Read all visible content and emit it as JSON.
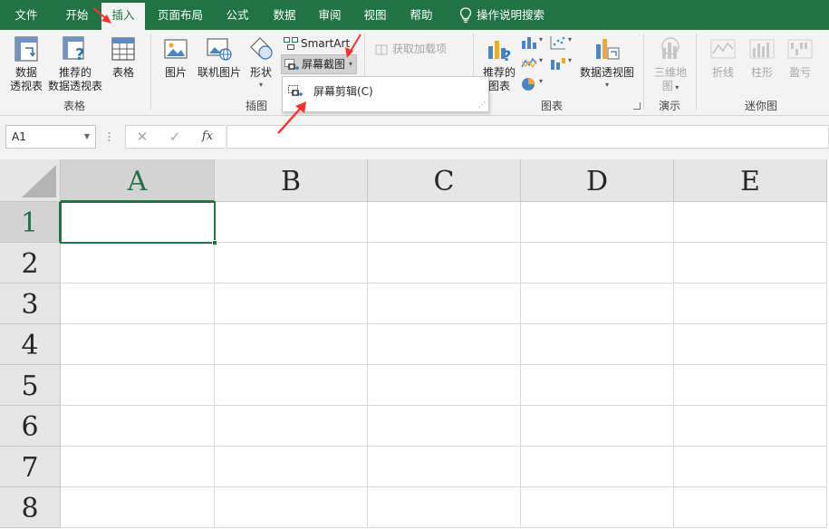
{
  "menu": {
    "tabs": [
      "文件",
      "开始",
      "插入",
      "页面布局",
      "公式",
      "数据",
      "审阅",
      "视图",
      "帮助"
    ],
    "active_tab": "插入",
    "search_label": "操作说明搜索"
  },
  "ribbon": {
    "groups": {
      "tables": "表格",
      "illustrations": "插图",
      "charts": "图表",
      "tours": "演示",
      "sparklines": "迷你图"
    },
    "buttons": {
      "pivot_table_line1": "数据",
      "pivot_table_line2": "透视表",
      "recommended_pivot_line1": "推荐的",
      "recommended_pivot_line2": "数据透视表",
      "table": "表格",
      "pictures": "图片",
      "online_pictures": "联机图片",
      "shapes": "形状",
      "smartart": "SmartArt",
      "screenshot": "屏幕截图",
      "get_addins": "获取加载项",
      "recommended_charts_line1": "推荐的",
      "recommended_charts_line2": "图表",
      "pivot_chart": "数据透视图",
      "map3d_line1": "三维地",
      "map3d_line2": "图",
      "spark_line": "折线",
      "spark_column": "柱形",
      "spark_winloss": "盈亏"
    }
  },
  "screenshot_menu": {
    "items": [
      "屏幕剪辑(C)"
    ]
  },
  "formula_bar": {
    "name_box": "A1",
    "cancel_symbol": "✕",
    "enter_symbol": "✓",
    "fx_symbol": "fx",
    "formula": ""
  },
  "sheet": {
    "columns": [
      "A",
      "B",
      "C",
      "D",
      "E"
    ],
    "rows": [
      "1",
      "2",
      "3",
      "4",
      "5",
      "6",
      "7",
      "8"
    ],
    "active_cell": "A1"
  },
  "colors": {
    "accent": "#217346",
    "ribbon_bg": "#f3f3f3",
    "header_bg": "#e6e6e6",
    "annotation": "#ff3030"
  }
}
